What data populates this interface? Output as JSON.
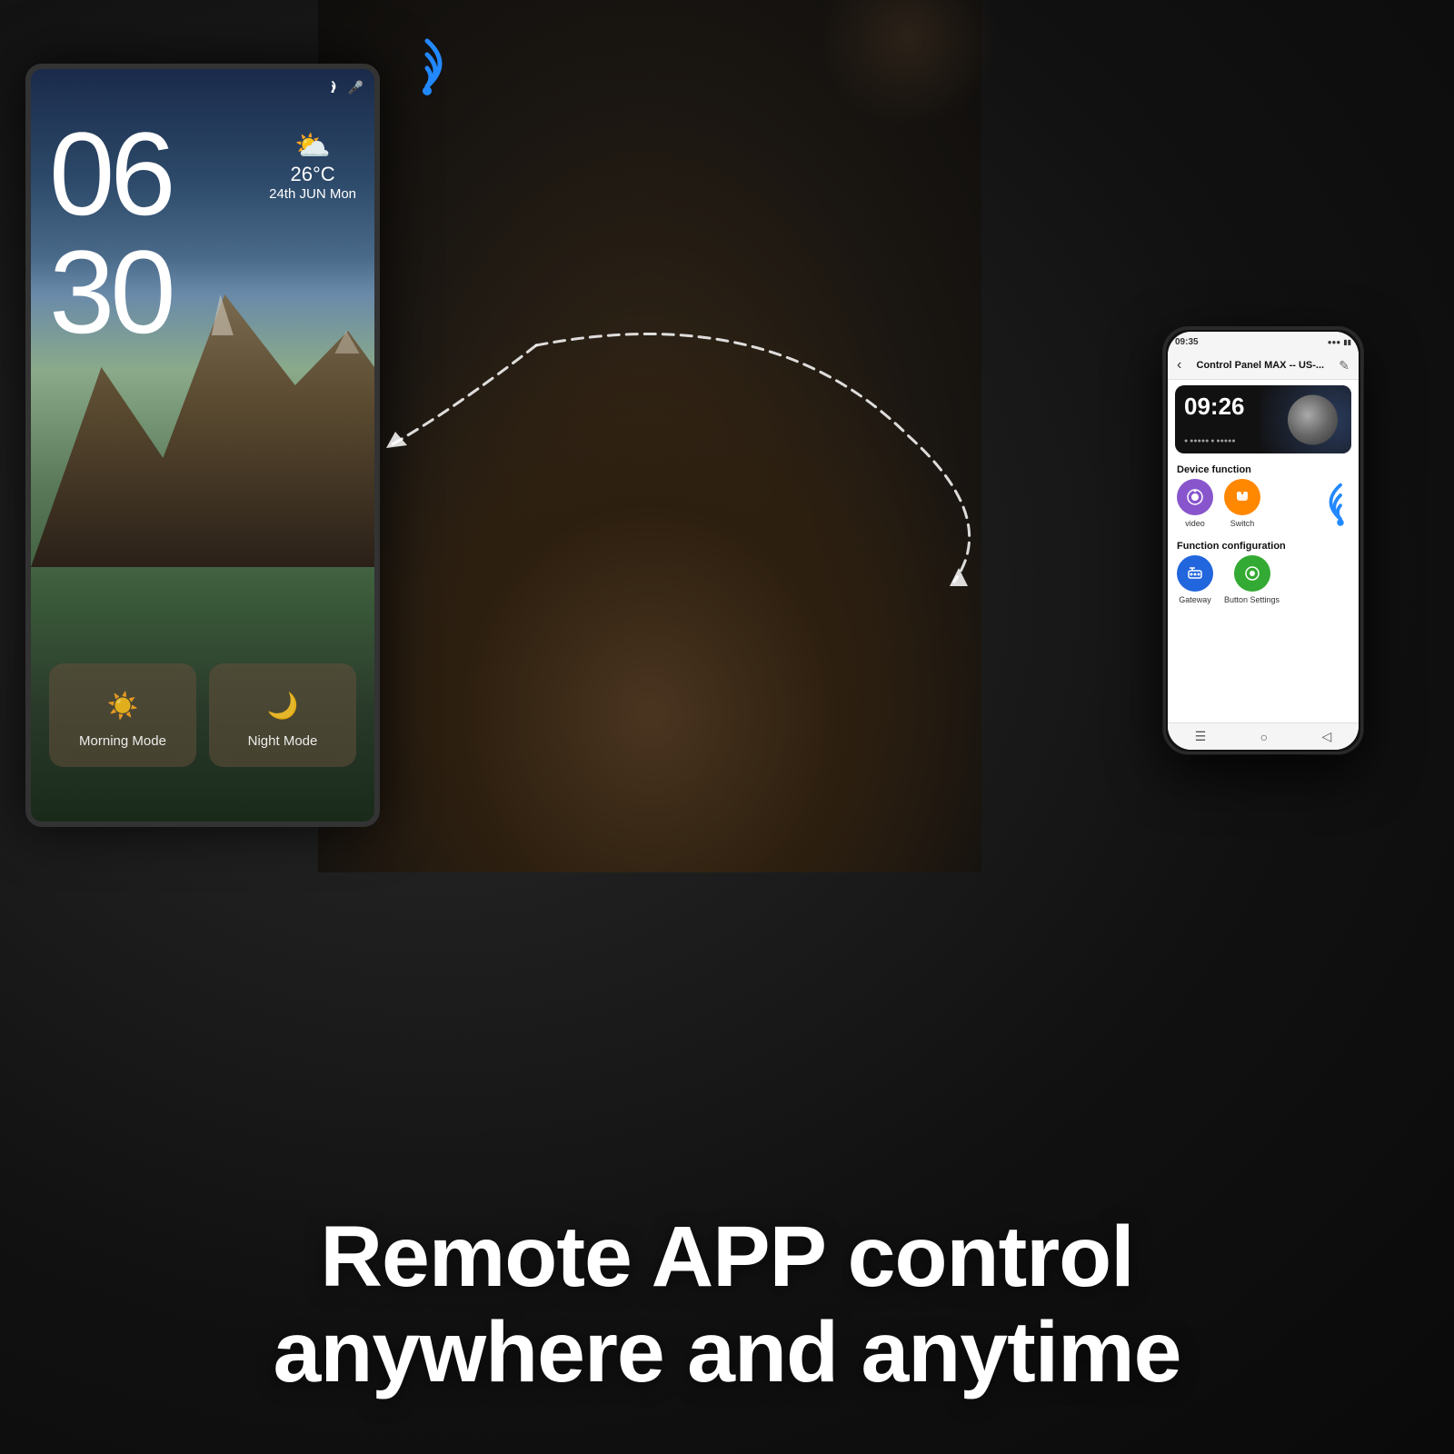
{
  "background": {
    "color": "#1a1a1a"
  },
  "tablet": {
    "time_hour": "06",
    "time_minute": "30",
    "weather_icon": "⛅",
    "weather_temp": "26°C",
    "weather_date": "24th JUN  Mon",
    "morning_mode_icon": "☀",
    "morning_mode_label": "Morning Mode",
    "night_mode_icon": "🌙",
    "night_mode_label": "Night Mode"
  },
  "smartphone": {
    "status_time": "09:35",
    "app_title": "Control Panel MAX -- US-...",
    "clock_time": "09:26",
    "device_function_title": "Device function",
    "function_config_title": "Function configuration",
    "video_label": "video",
    "switch_label": "Switch",
    "gateway_label": "Gateway",
    "button_settings_label": "Button Settings"
  },
  "bottom_text": {
    "line1": "Remote APP control",
    "line2": "anywhere and anytime"
  },
  "wifi_signals": {
    "tablet_wifi": "wifi-signal",
    "phone_wifi": "wifi-signal"
  }
}
